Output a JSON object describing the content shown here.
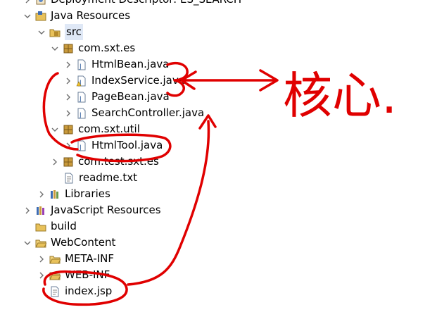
{
  "tree": {
    "deployment": "Deployment Descriptor: ES_SEARCH",
    "java_resources": "Java Resources",
    "src": "src",
    "pkg_es": "com.sxt.es",
    "files_es": [
      "HtmlBean.java",
      "IndexService.java",
      "PageBean.java",
      "SearchController.java"
    ],
    "pkg_util": "com.sxt.util",
    "file_util": "HtmlTool.java",
    "pkg_test": "com.test.sxt.es",
    "readme": "readme.txt",
    "libraries": "Libraries",
    "js_resources": "JavaScript Resources",
    "build": "build",
    "webcontent": "WebContent",
    "meta_inf": "META-INF",
    "web_inf": "WEB-INF",
    "index_jsp": "index.jsp"
  },
  "annotation": {
    "handwriting": "核心.",
    "ink_color": "#e00000"
  },
  "colors": {
    "selection": "#dfe8f6",
    "chevron": "#6e6e6e",
    "package": "#b58a2b",
    "folder": "#e8c15a",
    "java_file": "#2f5e9e"
  }
}
